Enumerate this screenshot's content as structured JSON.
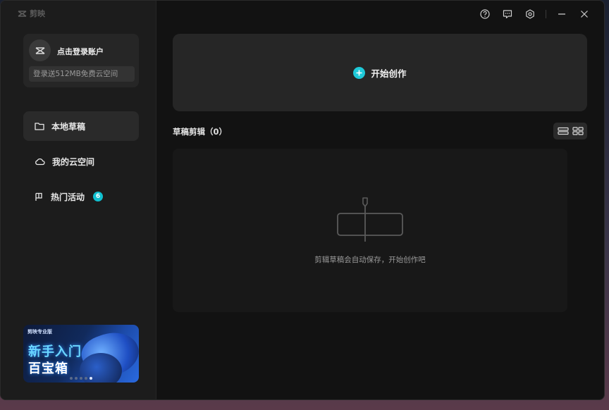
{
  "app": {
    "name": "剪映"
  },
  "account": {
    "login_label": "点击登录账户",
    "cloud_promo": "登录送512MB免费云空间"
  },
  "sidebar": {
    "items": [
      {
        "label": "本地草稿",
        "icon": "folder-icon",
        "active": true
      },
      {
        "label": "我的云空间",
        "icon": "cloud-icon",
        "active": false
      },
      {
        "label": "热门活动",
        "icon": "flag-icon",
        "active": false,
        "badge": "6"
      }
    ]
  },
  "banner": {
    "brand": "剪映专业版",
    "line1": "新手入门",
    "line2": "百宝箱",
    "slides_total": 5,
    "slide_active": 5
  },
  "titlebar": {
    "icons": [
      "help-icon",
      "feedback-icon",
      "settings-icon",
      "minimize-icon",
      "close-icon"
    ]
  },
  "main": {
    "create_label": "开始创作",
    "drafts_title": "草稿剪辑（0）",
    "empty_message": "剪辑草稿会自动保存，开始创作吧"
  },
  "colors": {
    "accent": "#1ec9d8",
    "window_bg": "#121212",
    "sidebar_bg": "#1c1c1c",
    "card_bg": "#262626"
  }
}
